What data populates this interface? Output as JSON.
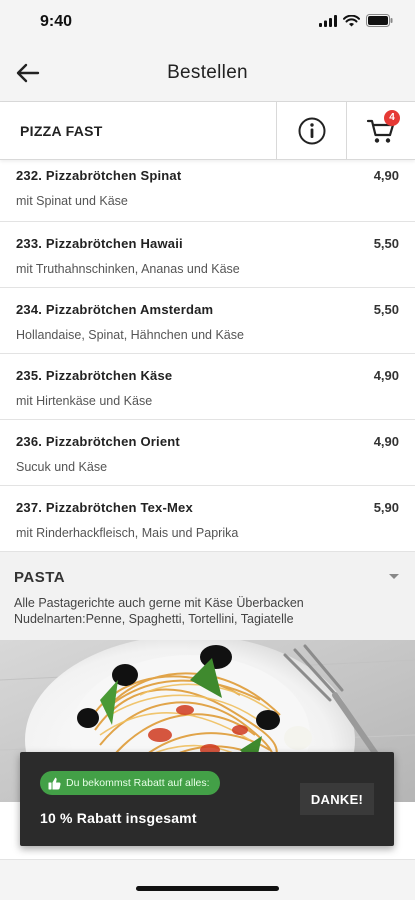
{
  "status_bar": {
    "time": "9:40",
    "icons": [
      "signal-icon",
      "wifi-icon",
      "battery-icon"
    ]
  },
  "nav": {
    "title": "Bestellen",
    "back_icon": "arrow-left-icon"
  },
  "shop": {
    "name": "PIZZA FAST",
    "info_icon": "info-icon",
    "cart_icon": "cart-icon",
    "cart_count": "4"
  },
  "menu_items": [
    {
      "name": "232. Pizzabrötchen Spinat",
      "description": "mit Spinat und Käse",
      "price": "4,90"
    },
    {
      "name": "233. Pizzabrötchen Hawaii",
      "description": "mit Truthahnschinken, Ananas und Käse",
      "price": "5,50"
    },
    {
      "name": "234. Pizzabrötchen Amsterdam",
      "description": "Hollandaise, Spinat, Hähnchen und Käse",
      "price": "5,50"
    },
    {
      "name": "235. Pizzabrötchen Käse",
      "description": "mit Hirtenkäse und Käse",
      "price": "4,90"
    },
    {
      "name": "236. Pizzabrötchen Orient",
      "description": "Sucuk und Käse",
      "price": "4,90"
    },
    {
      "name": "237. Pizzabrötchen Tex-Mex",
      "description": "mit Rinderhackfleisch, Mais und Paprika",
      "price": "5,90"
    }
  ],
  "category": {
    "title": "PASTA",
    "description_line1": "Alle Pastagerichte auch gerne mit Käse Überbacken",
    "description_line2": "Nudelnarten:Penne, Spaghetti, Tortellini, Tagiatelle"
  },
  "toast": {
    "pill_text": "Du bekommst Rabatt auf alles:",
    "message": "10 % Rabatt insgesamt",
    "button_label": "DANKE!",
    "accent_color": "#43a047"
  }
}
